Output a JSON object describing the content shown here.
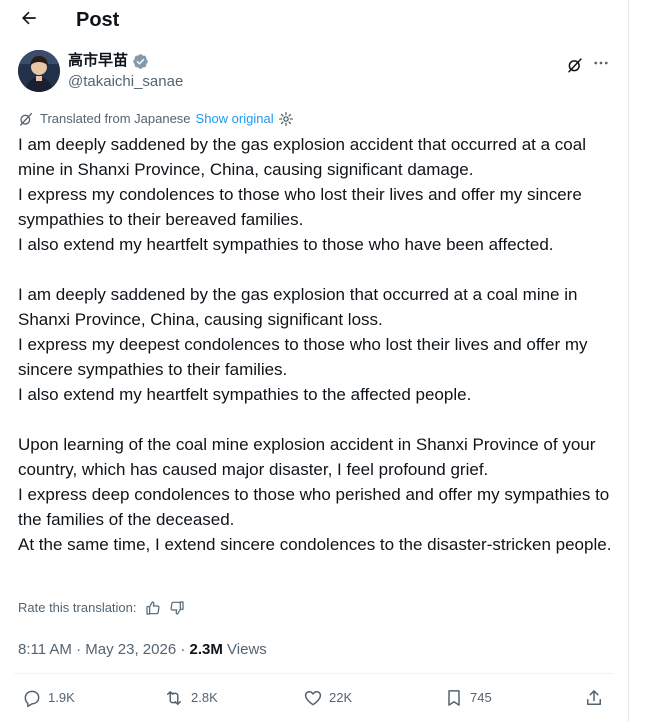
{
  "header": {
    "title": "Post"
  },
  "author": {
    "name": "高市早苗",
    "handle": "@takaichi_sanae",
    "verified": true
  },
  "translation": {
    "label": "Translated from Japanese",
    "show_original": "Show original"
  },
  "post": {
    "paragraphs": [
      "I am deeply saddened by the gas explosion accident that occurred at a coal mine in Shanxi Province, China, causing significant damage.\nI express my condolences to those who lost their lives and offer my sincere sympathies to their bereaved families.\nI also extend my heartfelt sympathies to those who have been affected.",
      "I am deeply saddened by the gas explosion that occurred at a coal mine in Shanxi Province, China, causing significant loss.\nI express my deepest condolences to those who lost their lives and offer my sincere sympathies to their families.\nI also extend my heartfelt sympathies to the affected people.",
      "Upon learning of the coal mine explosion accident in Shanxi Province of your country, which has caused major disaster, I feel profound grief.\nI express deep condolences to those who perished and offer my sympathies to the families of the deceased.\nAt the same time, I extend sincere condolences to the disaster-stricken people."
    ]
  },
  "rate": {
    "label": "Rate this translation:"
  },
  "meta": {
    "time": "8:11 AM",
    "separator": " · ",
    "date": "May 23, 2026",
    "views_count": "2.3M",
    "views_label": "Views"
  },
  "actions": {
    "replies": "1.9K",
    "reposts": "2.8K",
    "likes": "22K",
    "bookmarks": "745"
  },
  "colors": {
    "accent": "#1d9bf0",
    "verified": "#829aab",
    "muted": "#536471"
  }
}
